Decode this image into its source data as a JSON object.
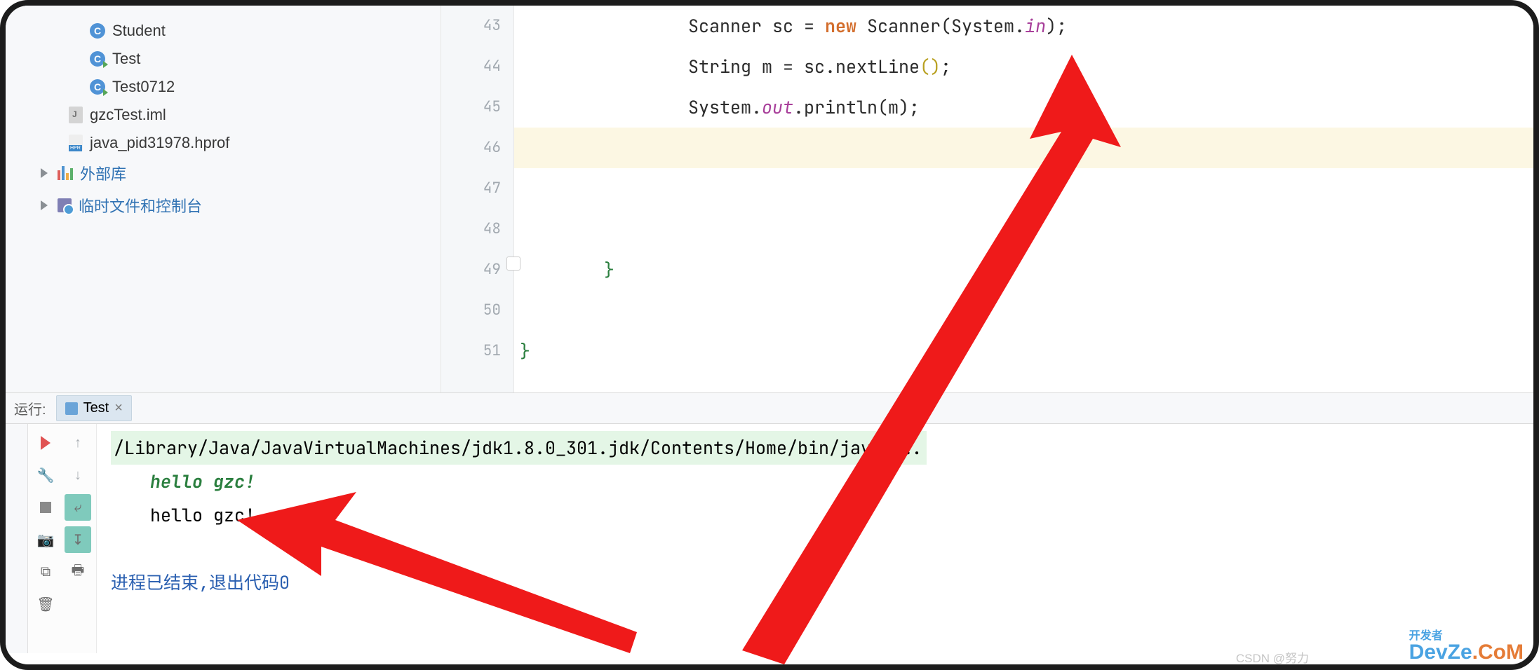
{
  "sidebar": {
    "items": [
      {
        "label": "Student",
        "icon": "class"
      },
      {
        "label": "Test",
        "icon": "class-run"
      },
      {
        "label": "Test0712",
        "icon": "class-run"
      },
      {
        "label": "gzcTest.iml",
        "icon": "iml"
      },
      {
        "label": "java_pid31978.hprof",
        "icon": "hprof"
      }
    ],
    "external_lib": "外部库",
    "scratches": "临时文件和控制台"
  },
  "editor": {
    "line_start": 43,
    "lines": {
      "l43": {
        "indent": "                ",
        "t1": "Scanner sc = ",
        "kw": "new",
        "t2": " Scanner(System.",
        "field": "in",
        "t3": ");"
      },
      "l44": {
        "indent": "                ",
        "t1": "String m = sc.nextLine",
        "p": "()",
        "t2": ";"
      },
      "l45": {
        "indent": "                ",
        "t1": "System.",
        "field": "out",
        "t2": ".println(m);"
      },
      "l46": "",
      "l47": "",
      "l48": "",
      "l49": {
        "indent": "        ",
        "brace": "}"
      },
      "l50": "",
      "l51": {
        "indent": "",
        "brace": "}"
      }
    },
    "line_numbers": [
      "43",
      "44",
      "45",
      "46",
      "47",
      "48",
      "49",
      "50",
      "51"
    ]
  },
  "run": {
    "panel_label": "运行:",
    "tab_name": "Test",
    "command": "/Library/Java/JavaVirtualMachines/jdk1.8.0_301.jdk/Contents/Home/bin/java ...",
    "input": "hello gzc!",
    "output": "hello gzc!",
    "exit": "进程已结束,退出代码0"
  },
  "watermark": {
    "csdn": "CSDN @努力",
    "dev_top": "开发者",
    "dev1": "DevZe",
    "dev2": ".CoM"
  }
}
